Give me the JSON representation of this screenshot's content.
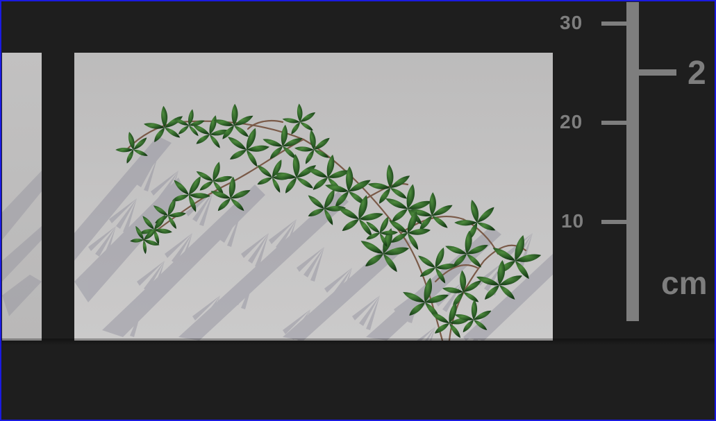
{
  "scene": {
    "description_icon": "ivy-vine-on-wall",
    "colors": {
      "background": "#1e1e1e",
      "wall": "#bfbebe",
      "scale": "#7e7e7e",
      "leaf_dark": "#1f4a1f",
      "leaf_light": "#3f7a32",
      "frame": "#1a1ae0"
    }
  },
  "scale": {
    "ticks": [
      "30",
      "20",
      "10"
    ],
    "partial_tick": "2",
    "unit": "cm"
  }
}
